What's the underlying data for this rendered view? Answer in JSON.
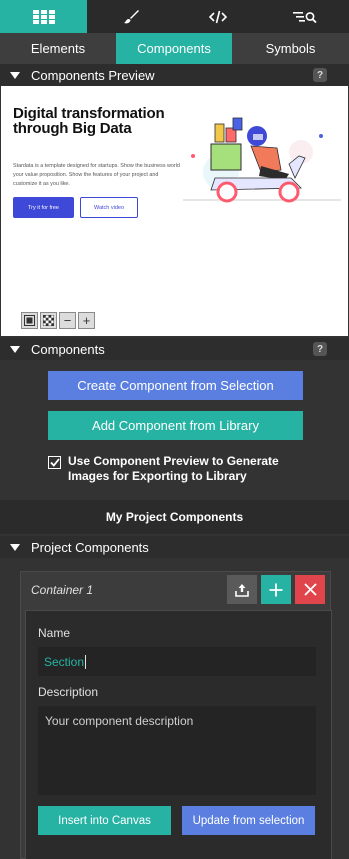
{
  "toolbar": {
    "tools": [
      {
        "icon": "grid-icon",
        "active": true
      },
      {
        "icon": "brush-icon",
        "active": false
      },
      {
        "icon": "code-icon",
        "active": false
      },
      {
        "icon": "search-list-icon",
        "active": false
      }
    ]
  },
  "tabs": [
    {
      "label": "Elements",
      "active": false
    },
    {
      "label": "Components",
      "active": true
    },
    {
      "label": "Symbols",
      "active": false
    }
  ],
  "preview_section": {
    "title": "Components Preview",
    "help": "?"
  },
  "preview": {
    "title": "Digital transformation through Big Data",
    "body": "Stardata is a template designed for startups. Show the business world your value proposition. Show the features of your project and customize it as you like.",
    "primary_button": "Try it for free",
    "secondary_button": "Watch video",
    "controls": [
      {
        "icon": "square-frame-icon"
      },
      {
        "icon": "checkerboard-icon"
      },
      {
        "icon": "minus-icon",
        "label": "−"
      },
      {
        "icon": "plus-icon",
        "label": "+"
      }
    ]
  },
  "components_section": {
    "title": "Components",
    "help": "?",
    "create_button": "Create Component from Selection",
    "add_button": "Add Component from Library",
    "checkbox_label": "Use Component Preview to Generate Images for Exporting to Library",
    "checkbox_checked": true
  },
  "my_project": {
    "heading": "My Project Components"
  },
  "project_section": {
    "title": "Project Components"
  },
  "component": {
    "name": "Container 1",
    "name_label": "Name",
    "name_value": "Section",
    "description_label": "Description",
    "description_placeholder": "Your component description",
    "insert_button": "Insert into Canvas",
    "update_button": "Update from selection"
  },
  "colors": {
    "teal": "#26b3a3",
    "blue": "#5b7fe0",
    "danger": "#e0454c",
    "brand_blue": "#3f49d8"
  }
}
